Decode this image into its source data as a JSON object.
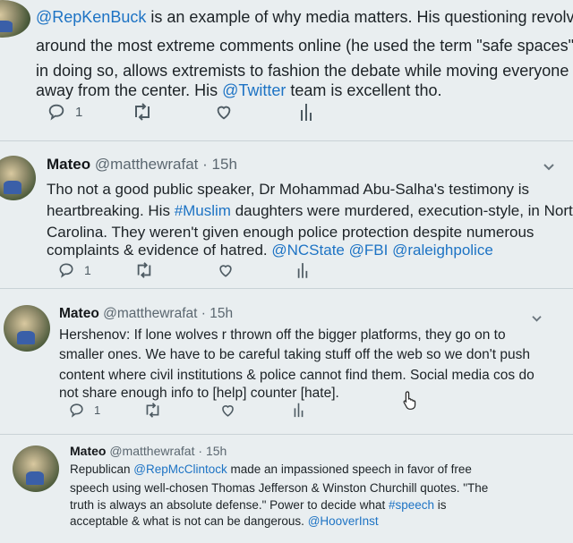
{
  "colors": {
    "link": "#1d73c4",
    "text": "#1c2226",
    "muted": "#5b6770",
    "background": "#e9eef0"
  },
  "tweets": [
    {
      "lines": [
        [
          {
            "t": "@RepKenBuck",
            "link": true
          },
          {
            "t": " is an example of why media matters. His questioning revolved"
          }
        ],
        [
          {
            "t": "around the most extreme comments online (he used the term \"safe spaces\") &"
          }
        ],
        [
          {
            "t": "in doing so, allows extremists to fashion the debate while moving everyone"
          }
        ],
        [
          {
            "t": "away from the center. His "
          },
          {
            "t": "@Twitter",
            "link": true
          },
          {
            "t": " team is excellent tho."
          }
        ]
      ],
      "reply_count": "1"
    },
    {
      "name": "Mateo",
      "handle": "@matthewrafat",
      "dot": "·",
      "time": "15h",
      "lines": [
        [
          {
            "t": "Tho not a good public speaker, Dr Mohammad Abu-Salha's testimony is"
          }
        ],
        [
          {
            "t": "heartbreaking. His "
          },
          {
            "t": "#Muslim",
            "link": true
          },
          {
            "t": " daughters were murdered, execution-style, in North"
          }
        ],
        [
          {
            "t": "Carolina. They weren't given enough police protection despite numerous"
          }
        ],
        [
          {
            "t": "complaints & evidence of hatred. "
          },
          {
            "t": "@NCState",
            "link": true
          },
          {
            "t": " "
          },
          {
            "t": "@FBI",
            "link": true
          },
          {
            "t": " "
          },
          {
            "t": "@raleighpolice",
            "link": true
          }
        ]
      ],
      "reply_count": "1"
    },
    {
      "name": "Mateo",
      "handle": "@matthewrafat",
      "dot": "·",
      "time": "15h",
      "lines": [
        [
          {
            "t": "Hershenov: If lone wolves r thrown off the bigger platforms, they go on to"
          }
        ],
        [
          {
            "t": "smaller ones. We have to be careful taking stuff off the web so we don't push"
          }
        ],
        [
          {
            "t": "content where civil institutions & police cannot find them. Social media cos do"
          }
        ],
        [
          {
            "t": "not share enough info to [help] counter [hate]."
          }
        ]
      ],
      "reply_count": "1"
    },
    {
      "name": "Mateo",
      "handle": "@matthewrafat",
      "dot": "·",
      "time": "15h",
      "lines": [
        [
          {
            "t": "Republican "
          },
          {
            "t": "@RepMcClintock",
            "link": true
          },
          {
            "t": " made an impassioned speech in favor of free"
          }
        ],
        [
          {
            "t": "speech using well-chosen Thomas Jefferson & Winston Churchill quotes. \"The"
          }
        ],
        [
          {
            "t": "truth is always an absolute defense.\" Power to decide what "
          },
          {
            "t": "#speech",
            "link": true
          },
          {
            "t": " is"
          }
        ],
        [
          {
            "t": "acceptable & what is not can be dangerous. "
          },
          {
            "t": "@HooverInst",
            "link": true
          }
        ]
      ]
    }
  ],
  "icons": {
    "reply": "reply-icon",
    "retweet": "retweet-icon",
    "like": "heart-icon",
    "analytics": "analytics-icon",
    "more": "chevron-down-icon",
    "cursor": "hand-pointer-icon"
  }
}
